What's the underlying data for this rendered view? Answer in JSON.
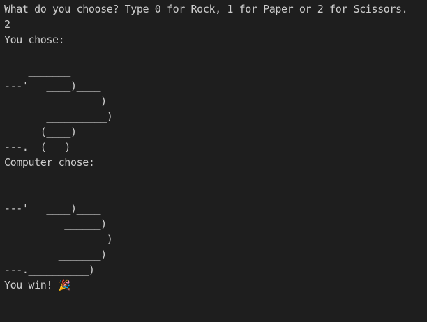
{
  "terminal": {
    "prompt": "What do you choose? Type 0 for Rock, 1 for Paper or 2 for Scissors.",
    "input": "2",
    "you_chose_label": "You chose:",
    "you_art": "\n    _______\n---'   ____)____\n          ______)\n       __________)\n      (____)\n---.__(___)\n",
    "computer_chose_label": "Computer chose:",
    "computer_art": "\n    _______\n---'   ____)____\n          ______)\n          _______)\n         _______)\n---.__________)\n",
    "result_text": "You win! ",
    "result_icon": "party-popper-icon",
    "result_icon_glyph": "🎉"
  }
}
